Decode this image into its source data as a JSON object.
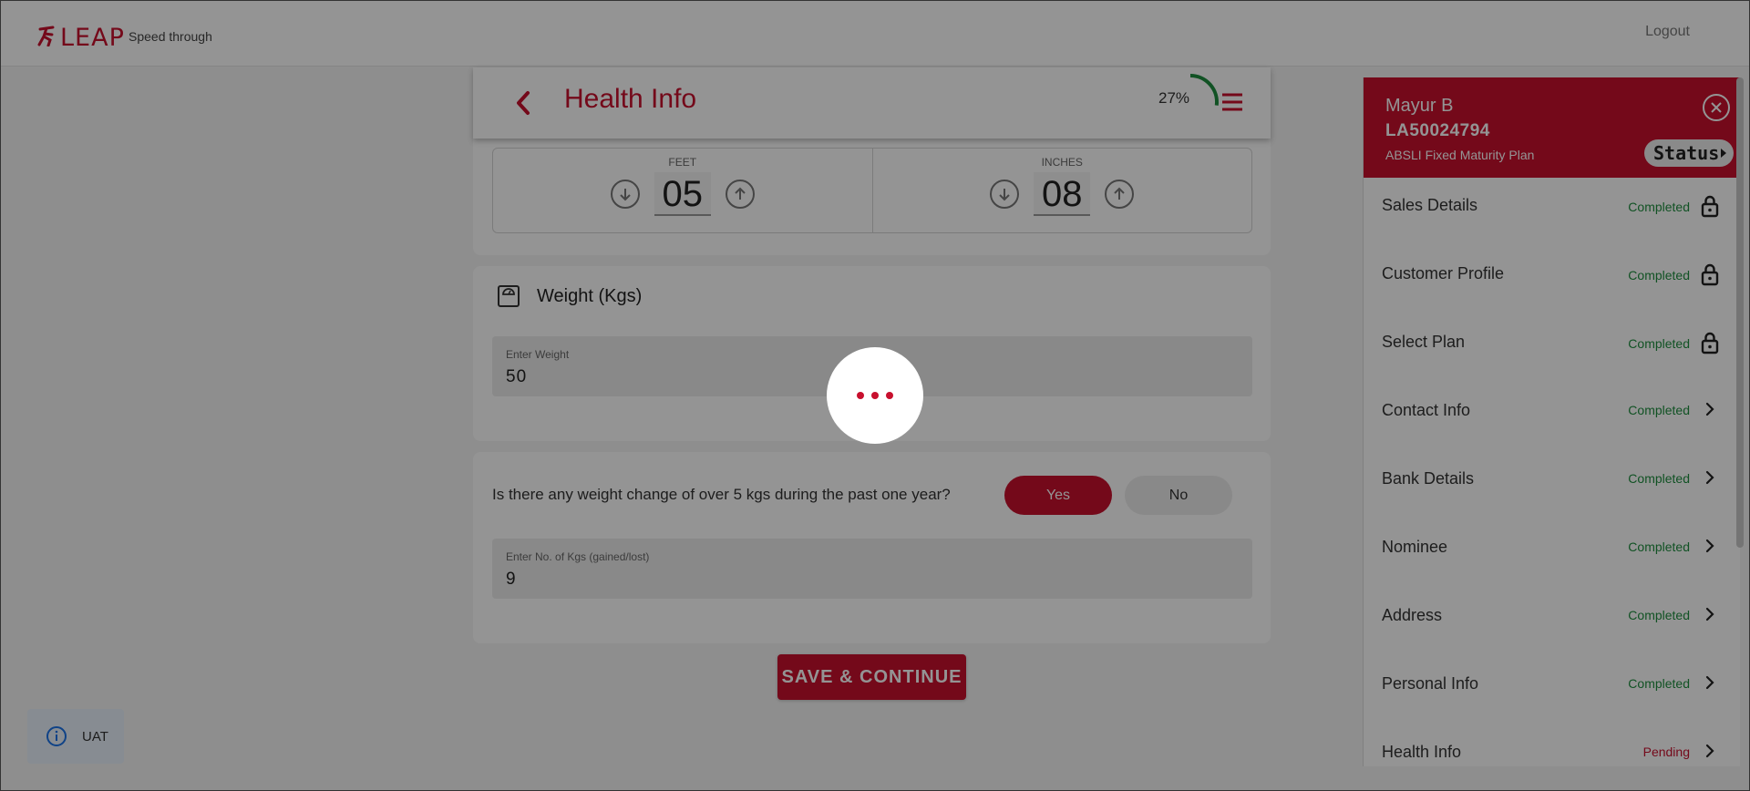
{
  "brand": {
    "logo_text": "LEAP",
    "tagline": "Speed through",
    "accent_color": "#c8102e"
  },
  "topbar": {
    "logout_label": "Logout"
  },
  "header": {
    "title": "Health Info",
    "progress_percent": 27,
    "progress_label": "27%"
  },
  "height": {
    "feet_label": "FEET",
    "feet_value": "05",
    "inches_label": "INCHES",
    "inches_value": "08"
  },
  "weight": {
    "title": "Weight (Kgs)",
    "field_label": "Enter Weight",
    "field_value": "50"
  },
  "weight_change": {
    "question": "Is there any weight change of over 5 kgs during the past one year?",
    "yes_label": "Yes",
    "no_label": "No",
    "selected": "Yes",
    "field_label": "Enter No. of Kgs (gained/lost)",
    "field_value": "9"
  },
  "save_label": "SAVE & CONTINUE",
  "env_badge": {
    "label": "UAT",
    "icon": "info-icon"
  },
  "side_panel": {
    "customer_name": "Mayur B",
    "application_id": "LA50024794",
    "plan_name": "ABSLI Fixed Maturity Plan",
    "status_label": "Status",
    "items": [
      {
        "label": "Sales Details",
        "status": "Completed",
        "icon": "lock-icon"
      },
      {
        "label": "Customer Profile",
        "status": "Completed",
        "icon": "lock-icon"
      },
      {
        "label": "Select Plan",
        "status": "Completed",
        "icon": "lock-icon"
      },
      {
        "label": "Contact Info",
        "status": "Completed",
        "icon": "chevron-right-icon"
      },
      {
        "label": "Bank Details",
        "status": "Completed",
        "icon": "chevron-right-icon"
      },
      {
        "label": "Nominee",
        "status": "Completed",
        "icon": "chevron-right-icon"
      },
      {
        "label": "Address",
        "status": "Completed",
        "icon": "chevron-right-icon"
      },
      {
        "label": "Personal Info",
        "status": "Completed",
        "icon": "chevron-right-icon"
      },
      {
        "label": "Health Info",
        "status": "Pending",
        "icon": "chevron-right-icon"
      }
    ]
  },
  "loading_overlay": true
}
